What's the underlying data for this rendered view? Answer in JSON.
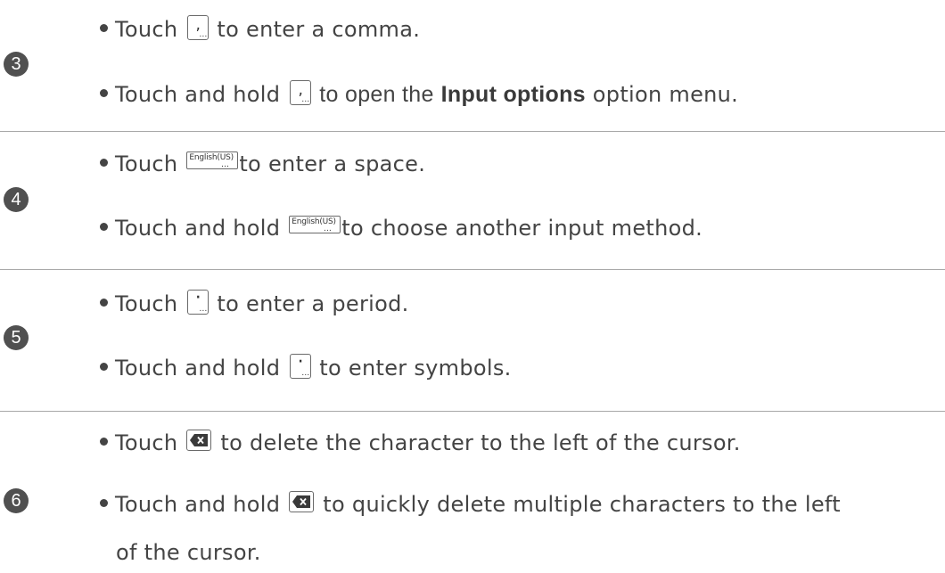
{
  "rows": [
    {
      "number": "3",
      "lines": [
        {
          "pre": "Touch",
          "post": "to enter a comma."
        },
        {
          "pre": "Touch and hold",
          "post_a": "to open the",
          "bold": "Input options",
          "post_b": "option menu."
        }
      ]
    },
    {
      "number": "4",
      "key_label": "English(US)",
      "lines": [
        {
          "pre": "Touch",
          "post": "to enter a space."
        },
        {
          "pre": "Touch and hold",
          "post": "to choose another input method."
        }
      ]
    },
    {
      "number": "5",
      "lines": [
        {
          "pre": "Touch",
          "post": "to enter a period."
        },
        {
          "pre": "Touch and hold",
          "post": "to enter symbols."
        }
      ]
    },
    {
      "number": "6",
      "lines": [
        {
          "pre": "Touch",
          "post": "to delete the character to the left of the cursor."
        },
        {
          "pre": "Touch and hold",
          "post": "to quickly delete multiple characters to the left",
          "cont": "of the cursor."
        }
      ]
    }
  ],
  "icons": {
    "comma_key": "comma-key-icon",
    "space_key": "english-us-space-key-icon",
    "period_key": "period-key-icon",
    "delete_key": "delete-key-icon"
  }
}
